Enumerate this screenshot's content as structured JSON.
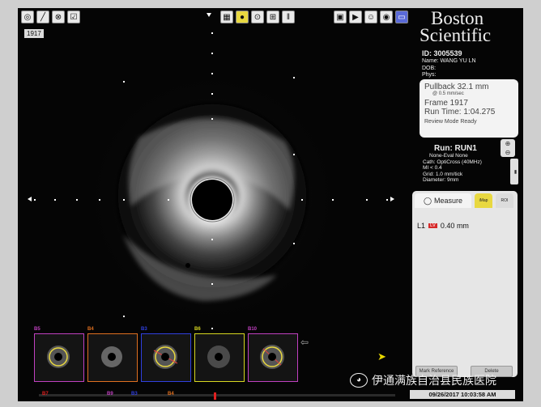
{
  "frame_badge": "1917",
  "brand": {
    "line1": "Boston",
    "line2": "Scientific"
  },
  "patient": {
    "id": "ID: 3005539",
    "name": "Name: WANG YU LN",
    "dob": "DOB:",
    "phys": "Phys:"
  },
  "pullback": {
    "title": "Pullback 32.1 mm",
    "rate": "@ 0.5 mm/sec",
    "frame": "Frame 1917",
    "runtime": "Run Time: 1:04.275",
    "mode": "Review Mode Ready"
  },
  "run": {
    "label": "Run: RUN1",
    "eval": "None-Eval None",
    "cath": "Cath: OptiCross (40MHz)",
    "mi": "MI <  0.4",
    "grid": "Grid:   1.0 mm/tick",
    "diameter": "Diameter:   9mm"
  },
  "measure_panel": {
    "tab_label": "Measure",
    "tab2": "iMap",
    "tab3": "ROI",
    "row_id": "L1",
    "row_tag": "LV",
    "row_value": "0.40 mm",
    "mark_button": "Mark Reference",
    "delete_button": "Delete"
  },
  "thumbnails": [
    {
      "label": "B5",
      "color": "#c040c0"
    },
    {
      "label": "B4",
      "color": "#e07020"
    },
    {
      "label": "B3",
      "color": "#3040e0"
    },
    {
      "label": "B6",
      "color": "#d8d820"
    },
    {
      "label": "B10",
      "color": "#c040c0"
    }
  ],
  "timeline_marks": [
    {
      "label": "B7",
      "color": "#e02020"
    },
    {
      "label": "B9",
      "color": "#c040c0"
    },
    {
      "label": "B3",
      "color": "#3040e0"
    },
    {
      "label": "B4",
      "color": "#e07020"
    }
  ],
  "watermark": "伊通满族自治县民族医院",
  "datetime": "09/26/2017  10:03:58 AM",
  "toolbar_left": [
    "select-icon",
    "draw-icon",
    "measure-icon",
    "check-icon"
  ],
  "toolbar_center": [
    "film-icon",
    "imap-icon",
    "tape-icon",
    "grid-icon",
    "ruler-icon"
  ],
  "toolbar_right": [
    "camera-icon",
    "play-icon",
    "person-icon",
    "image-icon",
    "screen-icon"
  ]
}
